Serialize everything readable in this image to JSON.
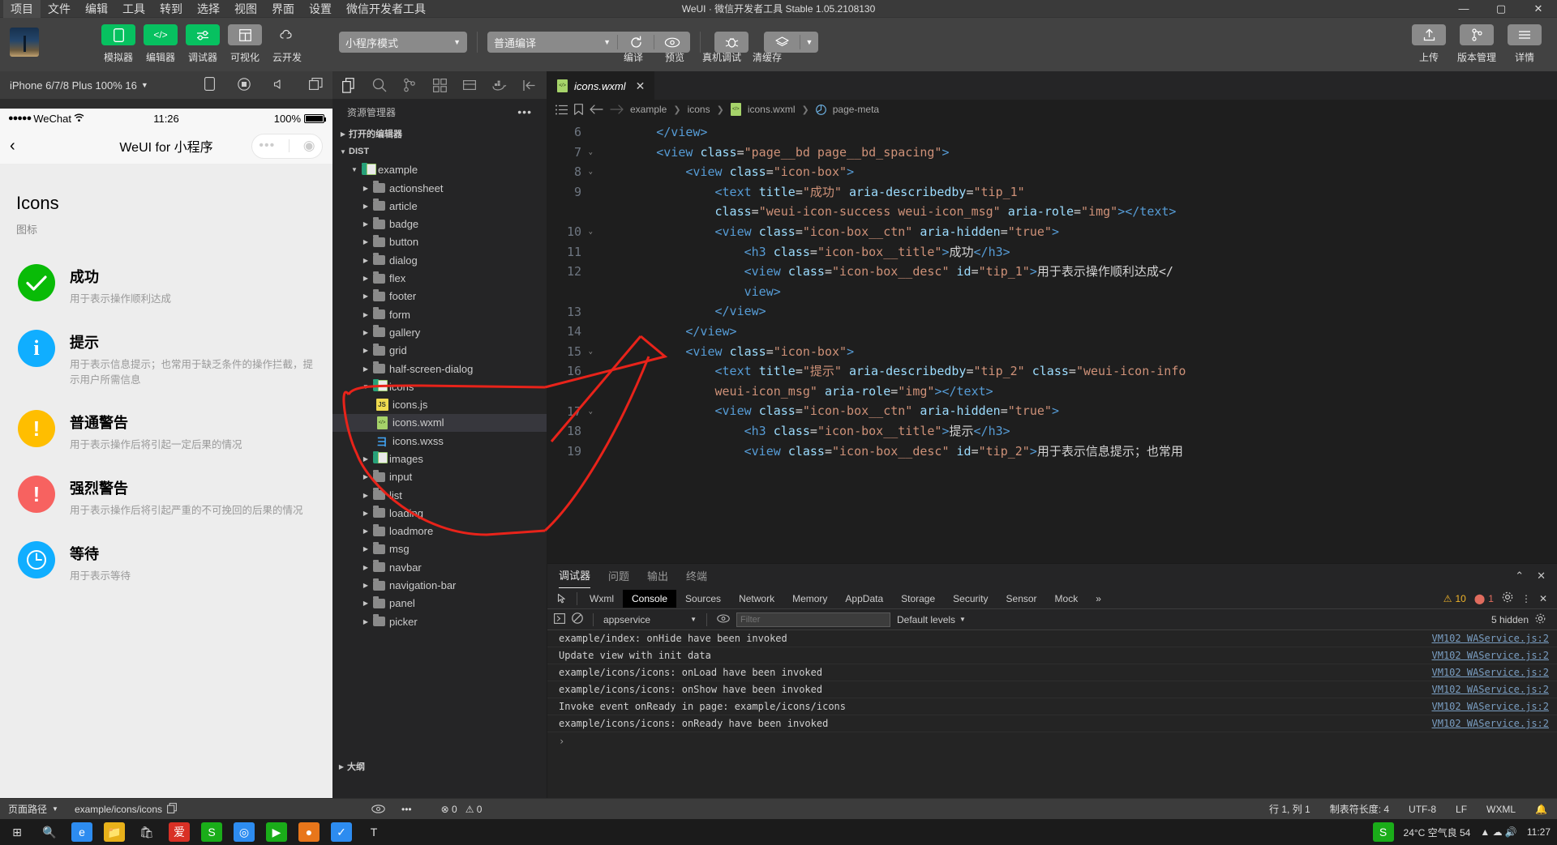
{
  "window": {
    "title": "WeUI · 微信开发者工具 Stable 1.05.2108130",
    "menus": [
      "项目",
      "文件",
      "编辑",
      "工具",
      "转到",
      "选择",
      "视图",
      "界面",
      "设置",
      "微信开发者工具"
    ],
    "active_menu": "项目",
    "controls": {
      "minimize": "—",
      "maximize": "▢",
      "close": "✕"
    }
  },
  "toolbar": {
    "buttons": [
      {
        "label": "模拟器",
        "icon": "phone-icon",
        "style": "green"
      },
      {
        "label": "编辑器",
        "icon": "code-icon",
        "style": "green"
      },
      {
        "label": "调试器",
        "icon": "sliders-icon",
        "style": "green"
      },
      {
        "label": "可视化",
        "icon": "layout-icon",
        "style": "grey"
      },
      {
        "label": "云开发",
        "icon": "cloud-icon",
        "style": "plain"
      }
    ],
    "mode_select": "小程序模式",
    "compile_select": "普通编译",
    "actions": [
      {
        "label": "编译",
        "icon": "refresh-icon"
      },
      {
        "label": "预览",
        "icon": "eye-icon"
      },
      {
        "label": "真机调试",
        "icon": "bug-icon"
      },
      {
        "label": "清缓存",
        "icon": "layers-icon"
      }
    ],
    "right_buttons": [
      {
        "label": "上传",
        "icon": "upload-icon"
      },
      {
        "label": "版本管理",
        "icon": "branch-icon"
      },
      {
        "label": "详情",
        "icon": "menu-icon"
      }
    ]
  },
  "simulator": {
    "device": "iPhone 6/7/8 Plus 100% 16",
    "tools": [
      "rotate-icon",
      "record-icon",
      "volume-icon",
      "window-icon"
    ],
    "status": {
      "carrier": "WeChat",
      "dots": "●●●●●",
      "time": "11:26",
      "battery": "100%"
    },
    "nav": {
      "back": "‹",
      "title": "WeUI for 小程序",
      "capsule_more": "•••",
      "capsule_target": "◉"
    },
    "page": {
      "title": "Icons",
      "subtitle": "图标",
      "icons": [
        {
          "name": "成功",
          "desc": "用于表示操作顺利达成",
          "color": "#09bb07",
          "glyph": "✓"
        },
        {
          "name": "提示",
          "desc": "用于表示信息提示；也常用于缺乏条件的操作拦截，提示用户所需信息",
          "color": "#10aeff",
          "glyph": "i"
        },
        {
          "name": "普通警告",
          "desc": "用于表示操作后将引起一定后果的情况",
          "color": "#ffbe00",
          "glyph": "!"
        },
        {
          "name": "强烈警告",
          "desc": "用于表示操作后将引起严重的不可挽回的后果的情况",
          "color": "#f76260",
          "glyph": "!"
        },
        {
          "name": "等待",
          "desc": "用于表示等待",
          "color": "#10aeff",
          "glyph": "🕐"
        }
      ]
    }
  },
  "explorer": {
    "activity_icons": [
      "files-icon",
      "search-icon",
      "source-control-icon",
      "extensions-icon",
      "debug-icon",
      "docker-icon",
      "collapse-icon"
    ],
    "title": "资源管理器",
    "sections": [
      {
        "label": "打开的编辑器",
        "expanded": false
      },
      {
        "label": "DIST",
        "expanded": true
      }
    ],
    "tree": [
      {
        "label": "example",
        "type": "folder-wx",
        "indent": 1,
        "twisty": "down"
      },
      {
        "label": "actionsheet",
        "type": "folder",
        "indent": 2,
        "twisty": "right"
      },
      {
        "label": "article",
        "type": "folder",
        "indent": 2,
        "twisty": "right"
      },
      {
        "label": "badge",
        "type": "folder",
        "indent": 2,
        "twisty": "right"
      },
      {
        "label": "button",
        "type": "folder",
        "indent": 2,
        "twisty": "right"
      },
      {
        "label": "dialog",
        "type": "folder",
        "indent": 2,
        "twisty": "right"
      },
      {
        "label": "flex",
        "type": "folder",
        "indent": 2,
        "twisty": "right"
      },
      {
        "label": "footer",
        "type": "folder",
        "indent": 2,
        "twisty": "right"
      },
      {
        "label": "form",
        "type": "folder",
        "indent": 2,
        "twisty": "right"
      },
      {
        "label": "gallery",
        "type": "folder",
        "indent": 2,
        "twisty": "right"
      },
      {
        "label": "grid",
        "type": "folder",
        "indent": 2,
        "twisty": "right"
      },
      {
        "label": "half-screen-dialog",
        "type": "folder",
        "indent": 2,
        "twisty": "right"
      },
      {
        "label": "icons",
        "type": "folder-wx",
        "indent": 2,
        "twisty": "down"
      },
      {
        "label": "icons.js",
        "type": "js",
        "indent": 3,
        "twisty": ""
      },
      {
        "label": "icons.wxml",
        "type": "wxml",
        "indent": 3,
        "twisty": "",
        "selected": true
      },
      {
        "label": "icons.wxss",
        "type": "wxss",
        "indent": 3,
        "twisty": ""
      },
      {
        "label": "images",
        "type": "folder-wx",
        "indent": 2,
        "twisty": "right"
      },
      {
        "label": "input",
        "type": "folder",
        "indent": 2,
        "twisty": "right"
      },
      {
        "label": "list",
        "type": "folder",
        "indent": 2,
        "twisty": "right"
      },
      {
        "label": "loading",
        "type": "folder",
        "indent": 2,
        "twisty": "right"
      },
      {
        "label": "loadmore",
        "type": "folder",
        "indent": 2,
        "twisty": "right"
      },
      {
        "label": "msg",
        "type": "folder",
        "indent": 2,
        "twisty": "right"
      },
      {
        "label": "navbar",
        "type": "folder",
        "indent": 2,
        "twisty": "right"
      },
      {
        "label": "navigation-bar",
        "type": "folder",
        "indent": 2,
        "twisty": "right"
      },
      {
        "label": "panel",
        "type": "folder",
        "indent": 2,
        "twisty": "right"
      },
      {
        "label": "picker",
        "type": "folder",
        "indent": 2,
        "twisty": "right"
      }
    ],
    "outline": "大纲"
  },
  "editor": {
    "tab": {
      "name": "icons.wxml",
      "close": "✕"
    },
    "breadcrumb": [
      "example",
      "icons",
      "icons.wxml",
      "page-meta"
    ],
    "lines": [
      {
        "num": "6",
        "fold": "",
        "html": "        <span class='t-tag'>&lt;/view&gt;</span>"
      },
      {
        "num": "7",
        "fold": "v",
        "html": "        <span class='t-tag'>&lt;view</span> <span class='t-attr'>class</span><span class='t-pln'>=</span><span class='t-str'>\"page__bd page__bd_spacing\"</span><span class='t-tag'>&gt;</span>"
      },
      {
        "num": "8",
        "fold": "v",
        "html": "            <span class='t-tag'>&lt;view</span> <span class='t-attr'>class</span><span class='t-pln'>=</span><span class='t-str'>\"icon-box\"</span><span class='t-tag'>&gt;</span>"
      },
      {
        "num": "9",
        "fold": "",
        "html": "                <span class='t-tag'>&lt;text</span> <span class='t-attr'>title</span><span class='t-pln'>=</span><span class='t-str'>\"成功\"</span> <span class='t-attr'>aria-describedby</span><span class='t-pln'>=</span><span class='t-str'>\"tip_1\"</span>"
      },
      {
        "num": "",
        "fold": "",
        "html": "                <span class='t-attr'>class</span><span class='t-pln'>=</span><span class='t-str'>\"weui-icon-success weui-icon_msg\"</span> <span class='t-attr'>aria-role</span><span class='t-pln'>=</span><span class='t-str'>\"img\"</span><span class='t-tag'>&gt;&lt;/text&gt;</span>"
      },
      {
        "num": "10",
        "fold": "v",
        "html": "                <span class='t-tag'>&lt;view</span> <span class='t-attr'>class</span><span class='t-pln'>=</span><span class='t-str'>\"icon-box__ctn\"</span> <span class='t-attr'>aria-hidden</span><span class='t-pln'>=</span><span class='t-str'>\"true\"</span><span class='t-tag'>&gt;</span>"
      },
      {
        "num": "11",
        "fold": "",
        "html": "                    <span class='t-tag'>&lt;h3</span> <span class='t-attr'>class</span><span class='t-pln'>=</span><span class='t-str'>\"icon-box__title\"</span><span class='t-tag'>&gt;</span><span class='t-txt'>成功</span><span class='t-tag'>&lt;/h3&gt;</span>"
      },
      {
        "num": "12",
        "fold": "",
        "html": "                    <span class='t-tag'>&lt;view</span> <span class='t-attr'>class</span><span class='t-pln'>=</span><span class='t-str'>\"icon-box__desc\"</span> <span class='t-attr'>id</span><span class='t-pln'>=</span><span class='t-str'>\"tip_1\"</span><span class='t-tag'>&gt;</span><span class='t-txt'>用于表示操作顺利达成&lt;/</span>"
      },
      {
        "num": "",
        "fold": "",
        "html": "                    <span class='t-tag'>view&gt;</span>"
      },
      {
        "num": "13",
        "fold": "",
        "html": "                <span class='t-tag'>&lt;/view&gt;</span>"
      },
      {
        "num": "14",
        "fold": "",
        "html": "            <span class='t-tag'>&lt;/view&gt;</span>"
      },
      {
        "num": "15",
        "fold": "v",
        "html": "            <span class='t-tag'>&lt;view</span> <span class='t-attr'>class</span><span class='t-pln'>=</span><span class='t-str'>\"icon-box\"</span><span class='t-tag'>&gt;</span>"
      },
      {
        "num": "16",
        "fold": "",
        "html": "                <span class='t-tag'>&lt;text</span> <span class='t-attr'>title</span><span class='t-pln'>=</span><span class='t-str'>\"提示\"</span> <span class='t-attr'>aria-describedby</span><span class='t-pln'>=</span><span class='t-str'>\"tip_2\"</span> <span class='t-attr'>class</span><span class='t-pln'>=</span><span class='t-str'>\"weui-icon-info</span>"
      },
      {
        "num": "",
        "fold": "",
        "html": "                <span class='t-str'>weui-icon_msg\"</span> <span class='t-attr'>aria-role</span><span class='t-pln'>=</span><span class='t-str'>\"img\"</span><span class='t-tag'>&gt;&lt;/text&gt;</span>"
      },
      {
        "num": "17",
        "fold": "v",
        "html": "                <span class='t-tag'>&lt;view</span> <span class='t-attr'>class</span><span class='t-pln'>=</span><span class='t-str'>\"icon-box__ctn\"</span> <span class='t-attr'>aria-hidden</span><span class='t-pln'>=</span><span class='t-str'>\"true\"</span><span class='t-tag'>&gt;</span>"
      },
      {
        "num": "18",
        "fold": "",
        "html": "                    <span class='t-tag'>&lt;h3</span> <span class='t-attr'>class</span><span class='t-pln'>=</span><span class='t-str'>\"icon-box__title\"</span><span class='t-tag'>&gt;</span><span class='t-txt'>提示</span><span class='t-tag'>&lt;/h3&gt;</span>"
      },
      {
        "num": "19",
        "fold": "",
        "html": "                    <span class='t-tag'>&lt;view</span> <span class='t-attr'>class</span><span class='t-pln'>=</span><span class='t-str'>\"icon-box__desc\"</span> <span class='t-attr'>id</span><span class='t-pln'>=</span><span class='t-str'>\"tip_2\"</span><span class='t-tag'>&gt;</span><span class='t-txt'>用于表示信息提示；也常用</span>"
      }
    ]
  },
  "console": {
    "panel_tabs": [
      "调试器",
      "问题",
      "输出",
      "终端"
    ],
    "panel_tab_active": "调试器",
    "devtool_tabs": [
      "Wxml",
      "Console",
      "Sources",
      "Network",
      "Memory",
      "AppData",
      "Storage",
      "Security",
      "Sensor",
      "Mock"
    ],
    "devtool_active": "Console",
    "more": "»",
    "warnings": "10",
    "errors": "1",
    "context": "appservice",
    "filter_placeholder": "Filter",
    "levels": "Default levels",
    "hidden": "5 hidden",
    "logs": [
      {
        "text": "example/index: onHide have been invoked",
        "source": "VM102 WAService.js:2"
      },
      {
        "text": "Update view with init data",
        "source": "VM102 WAService.js:2"
      },
      {
        "text": "example/icons/icons: onLoad have been invoked",
        "source": "VM102 WAService.js:2"
      },
      {
        "text": "example/icons/icons: onShow have been invoked",
        "source": "VM102 WAService.js:2"
      },
      {
        "text": "Invoke event onReady in page: example/icons/icons",
        "source": "VM102 WAService.js:2"
      },
      {
        "text": "example/icons/icons: onReady have been invoked",
        "source": "VM102 WAService.js:2"
      }
    ],
    "prompt": "›"
  },
  "statusbar": {
    "page_path_label": "页面路径",
    "current_path": "example/icons/icons",
    "problems_errors": "0",
    "problems_warnings": "0",
    "right": [
      "行 1, 列 1",
      "制表符长度: 4",
      "UTF-8",
      "LF",
      "WXML"
    ]
  },
  "taskbar": {
    "weather": "24°C  空气良 54",
    "time": "11:27"
  }
}
